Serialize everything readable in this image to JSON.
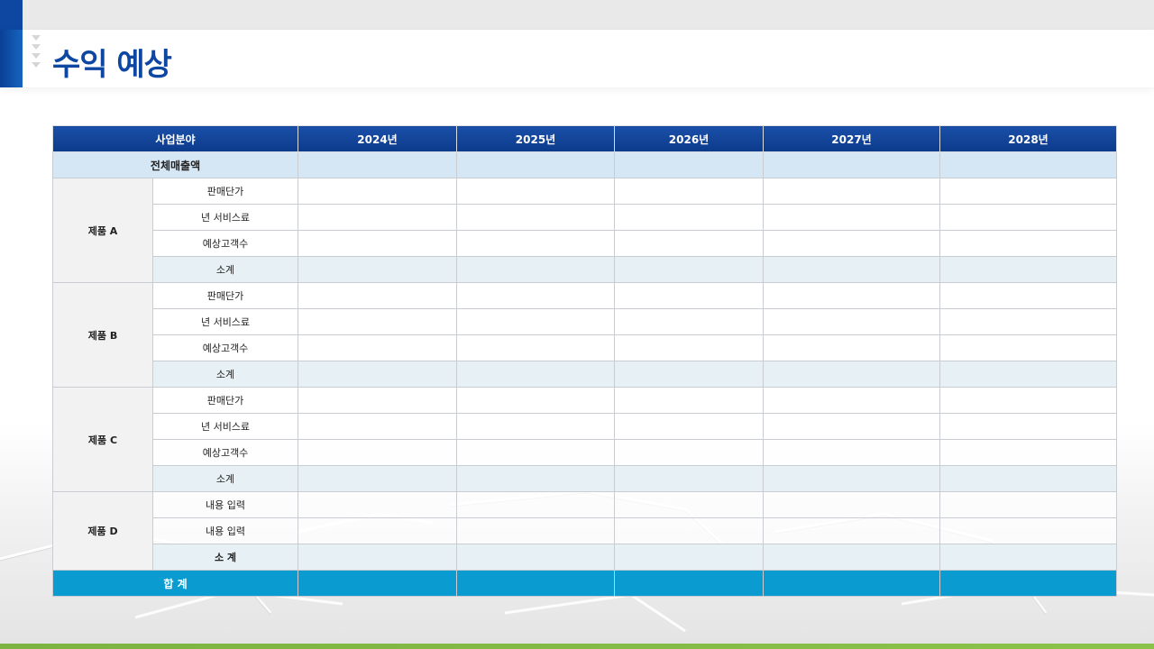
{
  "title": "수익 예상",
  "header": {
    "category": "사업분야",
    "years": [
      "2024년",
      "2025년",
      "2026년",
      "2027년",
      "2028년"
    ]
  },
  "total_revenue": "전체매출액",
  "groups": [
    {
      "name": "제품 A",
      "items": [
        "판매단가",
        "년 서비스료",
        "예상고객수"
      ],
      "subtotal": "소계"
    },
    {
      "name": "제품 B",
      "items": [
        "판매단가",
        "년 서비스료",
        "예상고객수"
      ],
      "subtotal": "소계"
    },
    {
      "name": "제품 C",
      "items": [
        "판매단가",
        "년 서비스료",
        "예상고객수"
      ],
      "subtotal": "소계"
    },
    {
      "name": "제품 D",
      "items": [
        "내용 입력",
        "내용 입력"
      ],
      "subtotal": "소 계"
    }
  ],
  "grand_total": "합 계",
  "colors": {
    "accent_blue": "#0d47a1",
    "total_row": "#d5e6f4",
    "subtotal_row": "#e7f0f4",
    "sum_row": "#0a9bd1",
    "bottom_line": "#8bc34a"
  }
}
